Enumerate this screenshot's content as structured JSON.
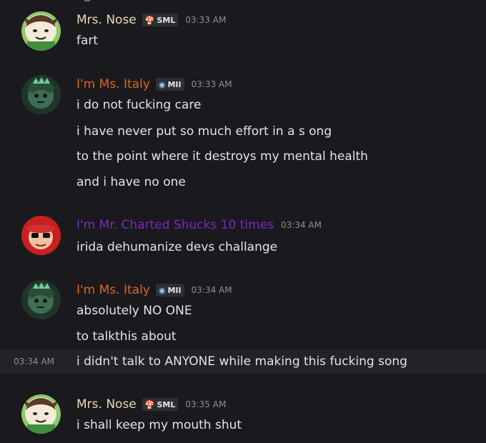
{
  "colors": {
    "background": "#1a1a1e",
    "hover": "#222227",
    "mrs_nose_name": "#e9d9b6",
    "ms_italy_name": "#e0641c",
    "mr_charted_name": "#7a28c4",
    "text": "#e3e4e8",
    "timestamp": "#8c8e96"
  },
  "messages": [
    {
      "author": "Mrs. Nose",
      "tag": "SML",
      "tag_icon": "mushroom-icon",
      "time": "03:33 AM",
      "lines": [
        "fart"
      ]
    },
    {
      "author": "I'm Ms. Italy",
      "tag": "MII",
      "tag_icon": "mii-icon",
      "time": "03:33 AM",
      "lines": [
        "i do not fucking care",
        "i have never put so much effort in a s ong",
        "to the point where it destroys my mental health",
        "and i have no one"
      ]
    },
    {
      "author": "I'm Mr. Charted Shucks 10 times",
      "time": "03:34 AM",
      "lines": [
        "irida dehumanize devs challange"
      ]
    },
    {
      "author": "I'm Ms. Italy",
      "tag": "MII",
      "tag_icon": "mii-icon",
      "time": "03:34 AM",
      "lines": [
        "absolutely NO ONE",
        "to talkthis about"
      ]
    },
    {
      "author": "Mrs. Nose",
      "tag": "SML",
      "tag_icon": "mushroom-icon",
      "time": "03:35 AM",
      "lines": [
        "i shall keep my mouth shut"
      ]
    }
  ],
  "continued_message": {
    "time": "03:34 AM",
    "text": "i didn't talk to ANYONE while making this fucking song"
  }
}
